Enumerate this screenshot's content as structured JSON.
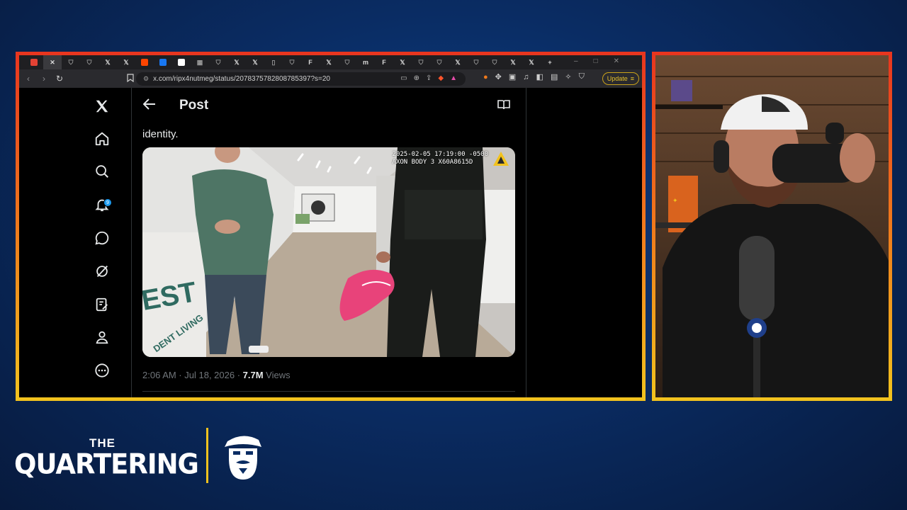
{
  "browser": {
    "tabs": [
      {
        "icon": "favicon-red-icon",
        "color": "#e34234"
      },
      {
        "icon": "close-icon",
        "label": "✕",
        "active": true
      },
      {
        "icon": "shield-icon"
      },
      {
        "icon": "shield-icon"
      },
      {
        "icon": "x-logo-icon",
        "label": "𝕏"
      },
      {
        "icon": "x-logo-icon",
        "label": "𝕏"
      },
      {
        "icon": "reddit-icon",
        "color": "#ff4500"
      },
      {
        "icon": "facebook-icon",
        "color": "#1877f2"
      },
      {
        "icon": "google-icon",
        "color": "#ffffff"
      },
      {
        "icon": "news-icon"
      },
      {
        "icon": "shield-icon"
      },
      {
        "icon": "x-logo-icon",
        "label": "𝕏"
      },
      {
        "icon": "x-logo-icon",
        "label": "𝕏"
      },
      {
        "icon": "doc-icon"
      },
      {
        "icon": "shield-icon"
      },
      {
        "icon": "f-icon",
        "label": "F"
      },
      {
        "icon": "x-logo-icon",
        "label": "𝕏"
      },
      {
        "icon": "shield-icon"
      },
      {
        "icon": "m-icon",
        "label": "m"
      },
      {
        "icon": "f-icon",
        "label": "F"
      },
      {
        "icon": "x-logo-icon",
        "label": "𝕏"
      },
      {
        "icon": "shield-icon"
      },
      {
        "icon": "shield-icon"
      },
      {
        "icon": "x-logo-icon",
        "label": "𝕏"
      },
      {
        "icon": "shield-icon"
      },
      {
        "icon": "shield-icon"
      },
      {
        "icon": "x-logo-icon",
        "label": "𝕏"
      },
      {
        "icon": "x-logo-icon",
        "label": "𝕏"
      },
      {
        "icon": "new-tab-icon",
        "label": "+"
      }
    ],
    "url": "x.com/ripx4nutmeg/status/2078375782808785397?s=20",
    "update_label": "Update"
  },
  "x_app": {
    "header_title": "Post",
    "notifications_count": "9",
    "tweet_text": "identity.",
    "video_overlay": {
      "line1": "2025-02-05 17:19:00 -0500",
      "line2": "AXON BODY 3 X60A8615D"
    },
    "meta": {
      "time": "2:06 AM · Jul 18, 2026 · ",
      "views_count": "7.7M",
      "views_label": " Views"
    }
  },
  "branding": {
    "the": "THE",
    "name": "QUARTERING",
    "colors": {
      "accent": "#f2c21e",
      "frame_top": "#e8361f",
      "frame_bottom": "#f2c21e",
      "x_blue": "#1d9bf0"
    }
  }
}
